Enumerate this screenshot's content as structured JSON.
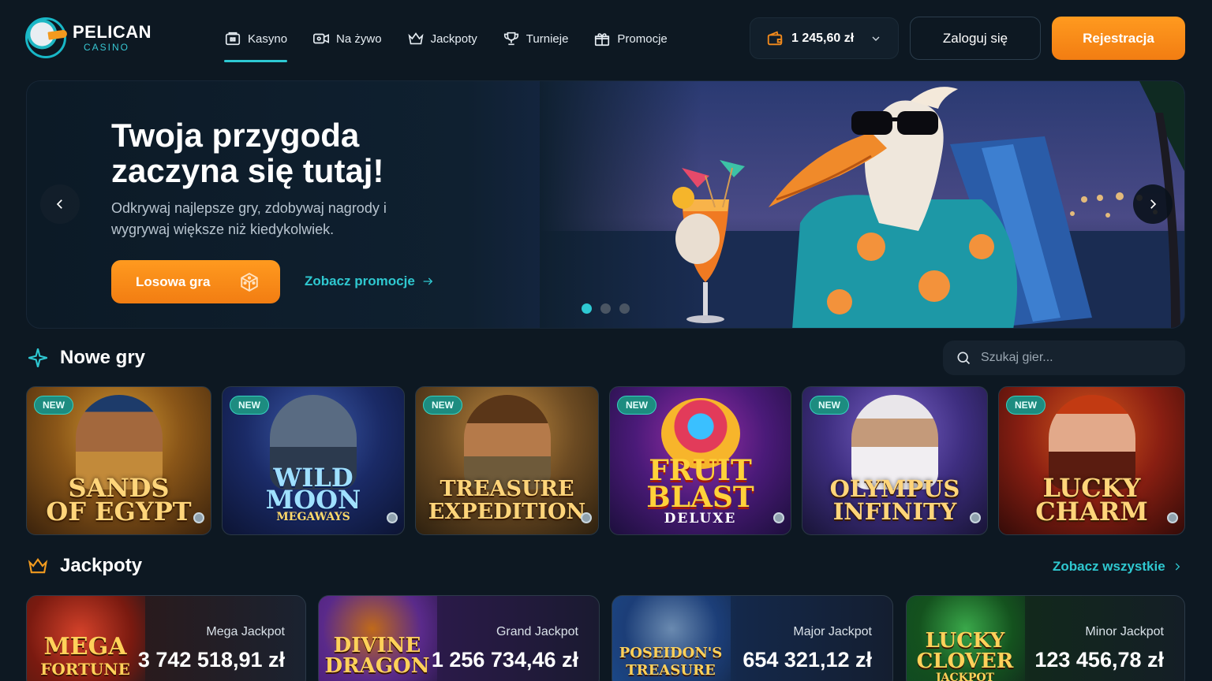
{
  "brand": {
    "name": "PELICAN",
    "sub": "CASINO"
  },
  "nav": [
    {
      "label": "Kasyno",
      "icon": "casino-icon",
      "active": true
    },
    {
      "label": "Na żywo",
      "icon": "live-camera-icon"
    },
    {
      "label": "Jackpoty",
      "icon": "crown-icon"
    },
    {
      "label": "Turnieje",
      "icon": "trophy-icon"
    },
    {
      "label": "Promocje",
      "icon": "gift-icon"
    }
  ],
  "wallet": {
    "balance": "1 245,60 zł"
  },
  "auth": {
    "login": "Zaloguj się",
    "register": "Rejestracja"
  },
  "hero": {
    "title": "Twoja przygoda zaczyna się tutaj!",
    "subtitle": "Odkrywaj najlepsze gry, zdobywaj nagrody i wygrywaj większe niż kiedykolwiek.",
    "cta": "Losowa gra",
    "link": "Zobacz promocje",
    "slides": 3,
    "active_slide": 1
  },
  "new_games": {
    "title": "Nowe gry",
    "search_placeholder": "Szukaj gier...",
    "badge": "NEW",
    "games": [
      {
        "line1": "SANDS",
        "line2": "OF EGYPT"
      },
      {
        "line1": "WILD",
        "line2": "MOON",
        "line3": "MEGAWAYS"
      },
      {
        "line1": "TREASURE",
        "line2": "EXPEDITION"
      },
      {
        "line1": "FRUIT",
        "line2": "BLAST",
        "line3": "DELUXE"
      },
      {
        "line1": "OLYMPUS",
        "line2": "INFINITY"
      },
      {
        "line1": "LUCKY",
        "line2": "CHARM"
      }
    ]
  },
  "jackpots": {
    "title": "Jackpoty",
    "see_all": "Zobacz wszystkie",
    "items": [
      {
        "label": "Mega Jackpot",
        "value": "3 742 518,91 zł",
        "art_line1": "MEGA",
        "art_line2": "FORTUNE"
      },
      {
        "label": "Grand Jackpot",
        "value": "1 256 734,46 zł",
        "art_line1": "DIVINE",
        "art_line2": "DRAGON"
      },
      {
        "label": "Major Jackpot",
        "value": "654 321,12 zł",
        "art_line1": "POSEIDON'S",
        "art_line2": "TREASURE"
      },
      {
        "label": "Minor Jackpot",
        "value": "123 456,78 zł",
        "art_line1": "LUCKY",
        "art_line2": "CLOVER",
        "art_line3": "JACKPOT"
      }
    ]
  },
  "colors": {
    "accent": "#2ec9d3",
    "cta": "#f5861a",
    "background": "#0d1822"
  }
}
